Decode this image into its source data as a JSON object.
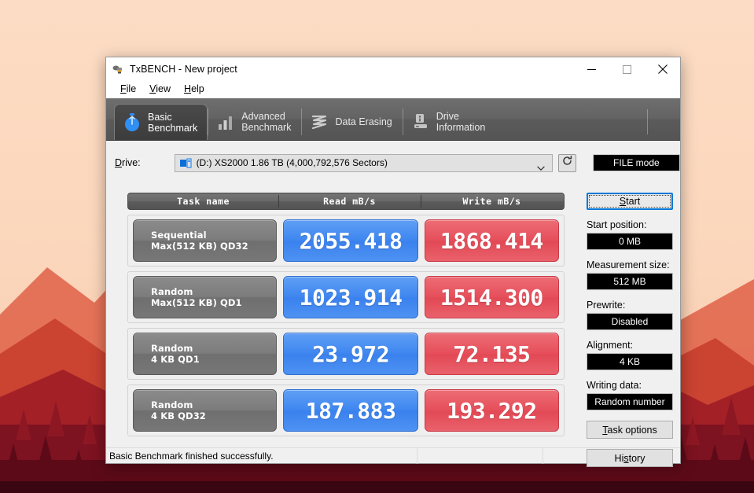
{
  "desktop": {
    "background_color": "#fbd9bf"
  },
  "window": {
    "title": "TxBENCH - New project",
    "app_icon": "txbench-icon",
    "controls": {
      "minimize": "—",
      "maximize": "□",
      "close": "✕"
    }
  },
  "menubar": {
    "items": [
      {
        "name": "file",
        "accel": "F",
        "rest": "ile"
      },
      {
        "name": "view",
        "accel": "V",
        "rest": "iew"
      },
      {
        "name": "help",
        "accel": "H",
        "rest": "elp"
      }
    ]
  },
  "tabs": [
    {
      "name": "basic-benchmark",
      "line1": "Basic",
      "line2": "Benchmark",
      "icon": "stopwatch-icon",
      "active": true
    },
    {
      "name": "advanced-benchmark",
      "line1": "Advanced",
      "line2": "Benchmark",
      "icon": "bar-chart-icon",
      "active": false
    },
    {
      "name": "data-erasing",
      "line1": "Data Erasing",
      "line2": "",
      "icon": "shredder-icon",
      "active": false
    },
    {
      "name": "drive-information",
      "line1": "Drive",
      "line2": "Information",
      "icon": "drive-info-icon",
      "active": false
    }
  ],
  "drive_row": {
    "label_accel": "D",
    "label_rest": "rive:",
    "selected_drive": "(D:) XS2000  1.86 TB (4,000,792,576 Sectors)",
    "refresh_icon": "refresh-icon",
    "dropdown_icon": "chevron-down-icon",
    "mode_button": "FILE mode"
  },
  "table": {
    "headers": [
      "Task name",
      "Read mB/s",
      "Write mB/s"
    ],
    "rows": [
      {
        "task_line1": "Sequential",
        "task_line2": "Max(512 KB) QD32",
        "read": "2055.418",
        "write": "1868.414"
      },
      {
        "task_line1": "Random",
        "task_line2": "Max(512 KB) QD1",
        "read": "1023.914",
        "write": "1514.300"
      },
      {
        "task_line1": "Random",
        "task_line2": "4 KB QD1",
        "read": "23.972",
        "write": "72.135"
      },
      {
        "task_line1": "Random",
        "task_line2": "4 KB QD32",
        "read": "187.883",
        "write": "193.292"
      }
    ]
  },
  "sidepanel": {
    "start_accel_pre": "S",
    "start_accel_post": "tart",
    "fields": [
      {
        "name": "start-position",
        "label": "Start position:",
        "value": "0 MB"
      },
      {
        "name": "measurement-size",
        "label": "Measurement size:",
        "value": "512 MB"
      },
      {
        "name": "prewrite",
        "label": "Prewrite:",
        "value": "Disabled"
      },
      {
        "name": "alignment",
        "label": "Alignment:",
        "value": "4 KB"
      },
      {
        "name": "writing-data",
        "label": "Writing data:",
        "value": "Random number"
      }
    ],
    "task_options": {
      "pre": "",
      "accel": "T",
      "post": "ask options"
    },
    "history": {
      "pre": "Hi",
      "accel": "s",
      "post": "tory"
    }
  },
  "statusbar": {
    "message": "Basic Benchmark finished successfully."
  },
  "colors": {
    "read_blue": "#3f87f0",
    "write_red": "#e64f5b",
    "tabstrip_gray": "#636363",
    "accent_focus": "#0078d7"
  }
}
